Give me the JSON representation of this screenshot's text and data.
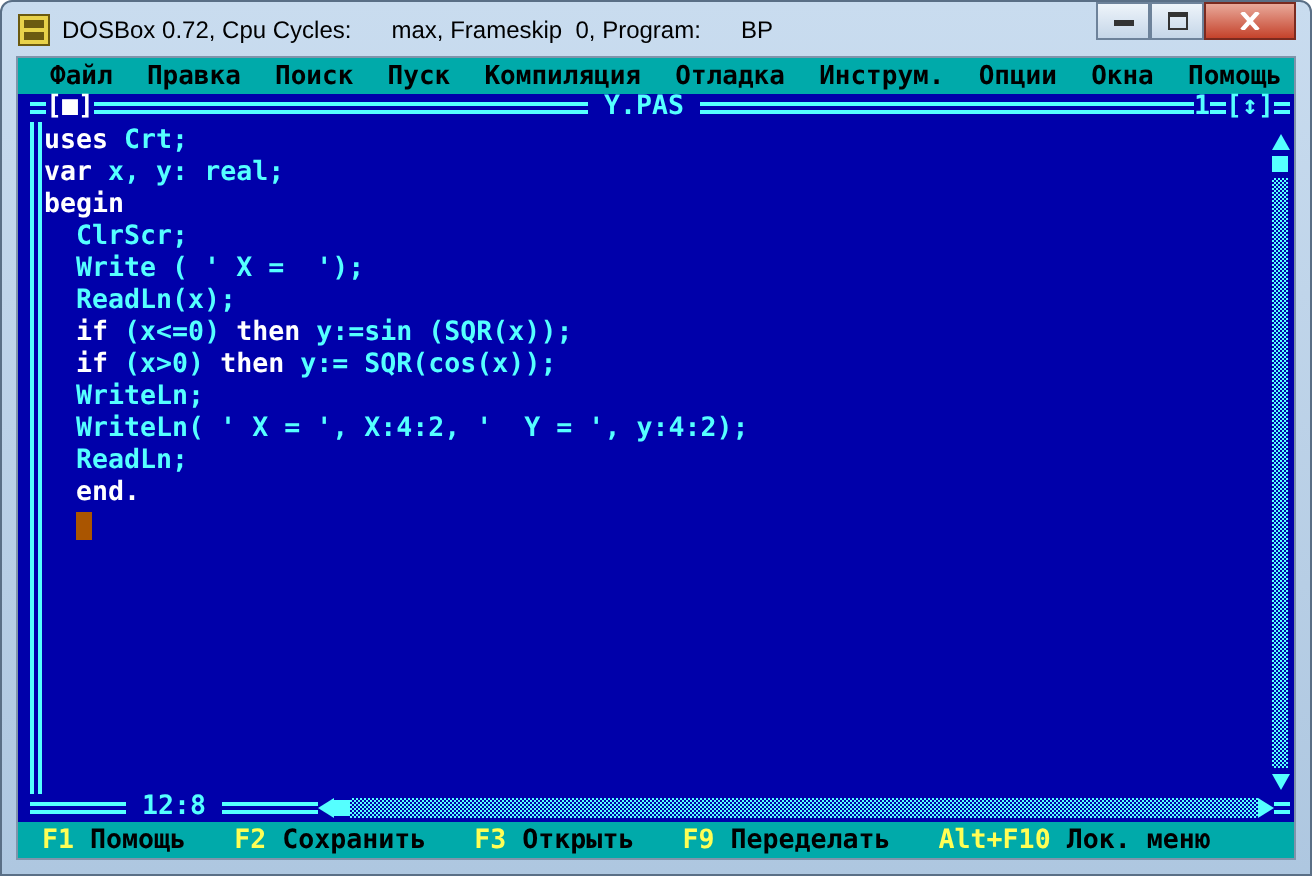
{
  "window": {
    "title": "DOSBox 0.72, Cpu Cycles:      max, Frameskip  0, Program:      BP"
  },
  "menu": [
    {
      "label": "Файл"
    },
    {
      "label": "Правка"
    },
    {
      "label": "Поиск"
    },
    {
      "label": "Пуск"
    },
    {
      "label": "Компиляция"
    },
    {
      "label": "Отладка"
    },
    {
      "label": "Инструм."
    },
    {
      "label": "Опции"
    },
    {
      "label": "Окна"
    },
    {
      "label": "Помощь"
    }
  ],
  "editor": {
    "close_box": "[■]",
    "title": "Y.PAS",
    "window_number": "1",
    "zoom_box": "[↕]",
    "position": "12:8",
    "lines": [
      {
        "segments": [
          {
            "text": "uses",
            "kind": "keyword"
          },
          {
            "text": " Crt;",
            "kind": "ident"
          }
        ],
        "cursor": false
      },
      {
        "segments": [
          {
            "text": "var",
            "kind": "keyword"
          },
          {
            "text": " x, y: real;",
            "kind": "ident"
          }
        ],
        "cursor": false
      },
      {
        "segments": [
          {
            "text": "begin",
            "kind": "keyword"
          }
        ],
        "cursor": false
      },
      {
        "segments": [
          {
            "text": "  ClrScr;",
            "kind": "ident"
          }
        ],
        "cursor": false
      },
      {
        "segments": [
          {
            "text": "  Write ( ' X =  ');",
            "kind": "ident"
          }
        ],
        "cursor": false
      },
      {
        "segments": [
          {
            "text": "  ReadLn(x);",
            "kind": "ident"
          }
        ],
        "cursor": false
      },
      {
        "segments": [
          {
            "text": "  if",
            "kind": "keyword"
          },
          {
            "text": " (x<=0) ",
            "kind": "ident"
          },
          {
            "text": "then",
            "kind": "keyword"
          },
          {
            "text": " y:=sin (SQR(x));",
            "kind": "ident"
          }
        ],
        "cursor": false
      },
      {
        "segments": [
          {
            "text": "  if",
            "kind": "keyword"
          },
          {
            "text": " (x>0) ",
            "kind": "ident"
          },
          {
            "text": "then",
            "kind": "keyword"
          },
          {
            "text": " y:= SQR(cos(x));",
            "kind": "ident"
          }
        ],
        "cursor": false
      },
      {
        "segments": [
          {
            "text": "  WriteLn;",
            "kind": "ident"
          }
        ],
        "cursor": false
      },
      {
        "segments": [
          {
            "text": "  WriteLn( ' X = ', X:4:2, '  Y = ', y:4:2);",
            "kind": "ident"
          }
        ],
        "cursor": false
      },
      {
        "segments": [
          {
            "text": "  ReadLn;",
            "kind": "ident"
          }
        ],
        "cursor": false
      },
      {
        "segments": [
          {
            "text": "  end.",
            "kind": "keyword"
          }
        ],
        "cursor": false
      },
      {
        "cursor": true
      }
    ]
  },
  "status_bar": [
    {
      "key": "F1",
      "label": "Помощь"
    },
    {
      "key": "F2",
      "label": "Сохранить"
    },
    {
      "key": "F3",
      "label": "Открыть"
    },
    {
      "key": "F9",
      "label": "Переделать"
    },
    {
      "key": "Alt+F10",
      "label": "Лок. меню"
    }
  ]
}
